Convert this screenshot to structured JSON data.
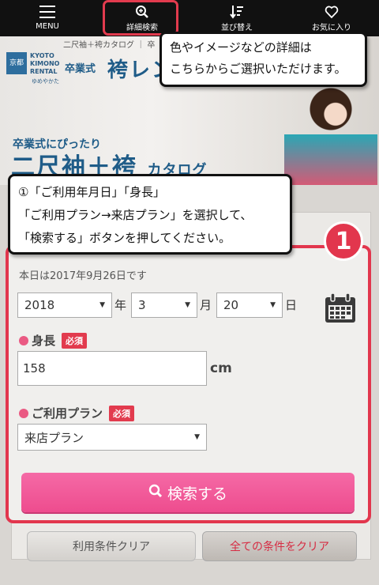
{
  "nav": {
    "items": [
      {
        "label": "MENU",
        "icon": "menu-icon"
      },
      {
        "label": "詳細検索",
        "icon": "search-plus-icon"
      },
      {
        "label": "並び替え",
        "icon": "sort-icon"
      },
      {
        "label": "お気に入り",
        "icon": "heart-icon"
      }
    ]
  },
  "banner": {
    "breadcrumb": "二尺袖＋袴カタログ ｜ 卒",
    "logo_mark": "京都",
    "logo_text_1": "KYOTO",
    "logo_text_2": "KIMONO",
    "logo_text_3": "RENTAL",
    "logo_sub": "ゆめやかた",
    "sotsu": "卒業式",
    "hakama": "袴レン",
    "catalog_sub": "卒業式にぴったり",
    "catalog_title": "二尺袖＋袴",
    "catalog_suffix": "カタログ"
  },
  "callout1": {
    "line1": "色やイメージなどの詳細は",
    "line2": "こちらからご選択いただけます。"
  },
  "callout2": {
    "line1": "①「ご利用年月日」「身長」",
    "line2": "「ご利用プラン→来店プラン」を選択して、",
    "line3": "「検索する」ボタンを押してください。"
  },
  "step_badge": "1",
  "form": {
    "today": "本日は2017年9月26日です",
    "year": "2018",
    "year_unit": "年",
    "month": "3",
    "month_unit": "月",
    "day": "20",
    "day_unit": "日",
    "height_label": "身長",
    "required": "必須",
    "height_value": "158",
    "height_unit": "cm",
    "plan_label": "ご利用プラン",
    "plan_value": "来店プラン",
    "search_label": "検索する",
    "clear_terms": "利用条件クリア",
    "clear_all": "全ての条件をクリア"
  },
  "colors": {
    "accent_red": "#e2364d",
    "search_pink": "#ee4c8e",
    "brand_blue": "#1f5c88"
  }
}
